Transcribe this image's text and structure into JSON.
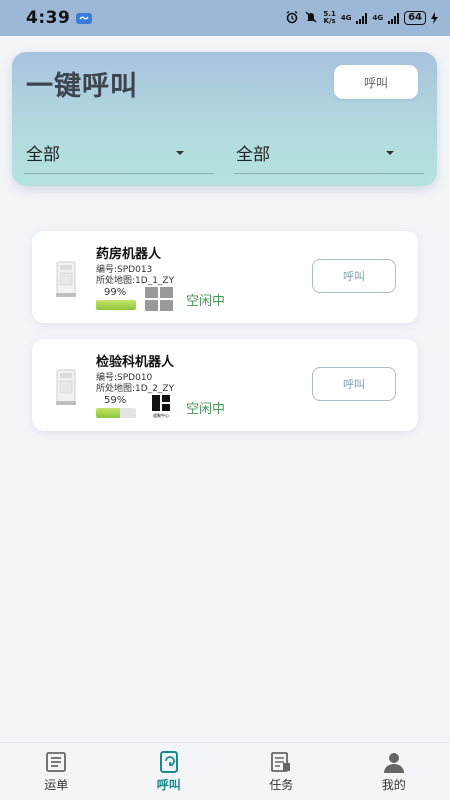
{
  "status_bar": {
    "time": "4:39",
    "net_speed_top": "5.1",
    "net_speed_bottom": "K/s",
    "network_1": "4G",
    "network_2": "4G",
    "battery": "64"
  },
  "header": {
    "title": "一键呼叫",
    "call_label": "呼叫",
    "filter_left": "全部",
    "filter_right": "全部"
  },
  "robots": [
    {
      "name": "药房机器人",
      "code": "编号:SPD013",
      "map": "所处地图:1D_1_ZY",
      "battery_label": "99%",
      "battery_level": 0.99,
      "status": "空闲中",
      "call_label": "呼叫",
      "map_icon": "grid-map-icon"
    },
    {
      "name": "检验科机器人",
      "code": "编号:SPD010",
      "map": "所处地图:1D_2_ZY",
      "battery_label": "59%",
      "battery_level": 0.59,
      "status": "空闲中",
      "call_label": "呼叫",
      "map_icon": "tile-logo-icon",
      "map_icon_caption": "遥聚中心"
    }
  ],
  "bottom_nav": {
    "items": [
      {
        "label": "运单",
        "icon": "document-list-icon",
        "active": false
      },
      {
        "label": "呼叫",
        "icon": "call-icon",
        "active": true
      },
      {
        "label": "任务",
        "icon": "task-icon",
        "active": false
      },
      {
        "label": "我的",
        "icon": "user-icon",
        "active": false
      }
    ],
    "active_color": "#1a8a8a"
  },
  "colors": {
    "status_green": "#4c9a5a",
    "header_gradient_top": "#a8c3de",
    "header_gradient_bottom": "#b4e3dd"
  }
}
